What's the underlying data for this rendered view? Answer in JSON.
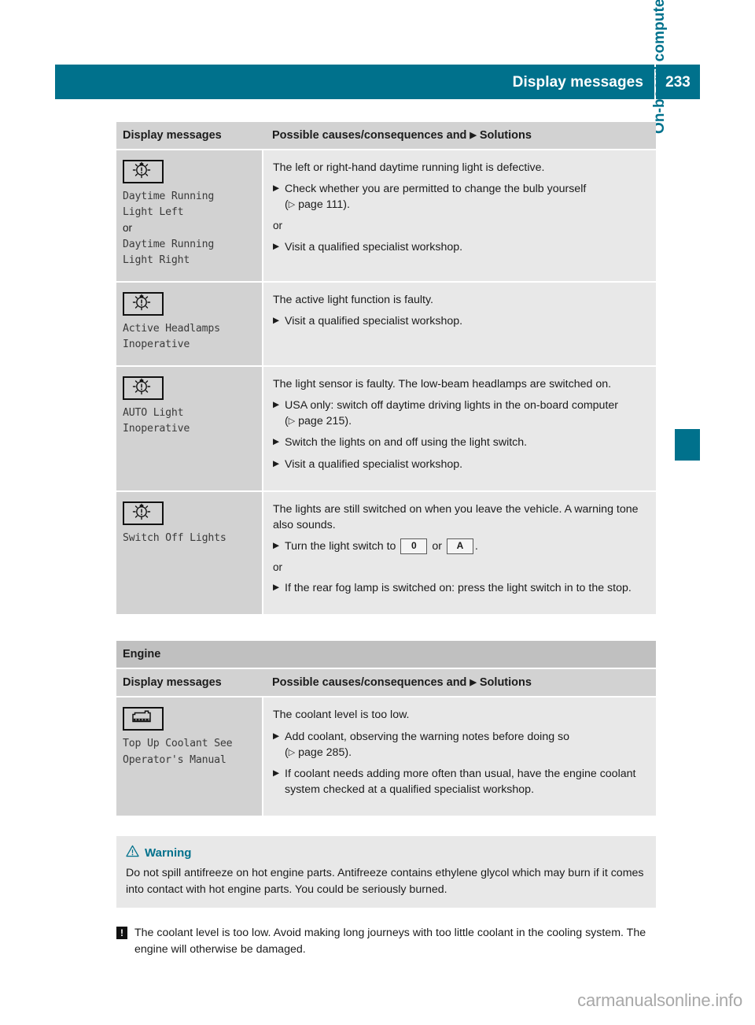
{
  "header": {
    "title": "Display messages",
    "page_number": "233",
    "accent_color": "#00718c"
  },
  "side_tab": {
    "label": "On-board computer and displays"
  },
  "table_headers": {
    "col1": "Display messages",
    "col2_prefix": "Possible causes/consequences and",
    "col2_suffix": "Solutions"
  },
  "lights_table": {
    "rows": [
      {
        "icon": "lamp-defect-icon",
        "message_lines": "Daytime Running\nLight Left",
        "message_or": "or",
        "message_lines2": "Daytime Running\nLight Right",
        "cause": "The left or right-hand daytime running light is defective.",
        "items": [
          "Check whether you are permitted to change the bulb yourself",
          "Visit a qualified specialist workshop."
        ],
        "item1_ref": "page 111",
        "or_label": "or"
      },
      {
        "icon": "lamp-defect-icon",
        "message_lines": "Active Headlamps\nInoperative",
        "cause": "The active light function is faulty.",
        "items": [
          "Visit a qualified specialist workshop."
        ]
      },
      {
        "icon": "lamp-defect-icon",
        "message_lines": "AUTO Light\nInoperative",
        "cause": "The light sensor is faulty. The low-beam headlamps are switched on.",
        "items": [
          "USA only: switch off daytime driving lights in the on-board computer",
          "Switch the lights on and off using the light switch.",
          "Visit a qualified specialist workshop."
        ],
        "item1_ref": "page 215"
      },
      {
        "icon": "lamp-defect-icon",
        "message_lines": "Switch Off Lights",
        "cause": "The lights are still switched on when you leave the vehicle. A warning tone also sounds.",
        "item_turn_prefix": "Turn the light switch to",
        "key_zero": "0",
        "key_or": "or",
        "key_auto": "A",
        "or_label": "or",
        "item_fog": "If the rear fog lamp is switched on: press the light switch in to the stop."
      }
    ]
  },
  "engine_section": {
    "title": "Engine",
    "rows": [
      {
        "icon": "coolant-level-icon",
        "message_lines": "Top Up Coolant See\nOperator's Manual",
        "cause": "The coolant level is too low.",
        "items": [
          "Add coolant, observing the warning notes before doing so",
          "If coolant needs adding more often than usual, have the engine coolant system checked at a qualified specialist workshop."
        ],
        "item1_ref": "page 285"
      }
    ]
  },
  "warning": {
    "icon": "warning-triangle-icon",
    "title": "Warning",
    "body": "Do not spill antifreeze on hot engine parts. Antifreeze contains ethylene glycol which may burn if it comes into contact with hot engine parts. You could be seriously burned."
  },
  "note": {
    "icon": "exclamation-icon",
    "icon_glyph": "!",
    "body": "The coolant level is too low. Avoid making long journeys with too little coolant in the cooling system. The engine will otherwise be damaged."
  },
  "watermark": {
    "text": "carmanualsonline.info"
  }
}
